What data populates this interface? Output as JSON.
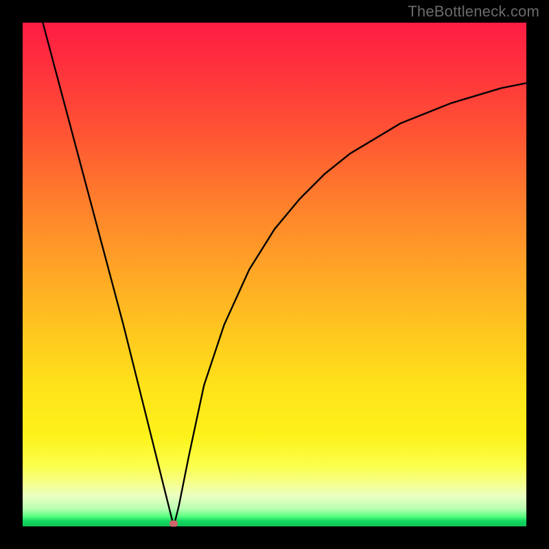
{
  "watermark": "TheBottleneck.com",
  "chart_data": {
    "type": "line",
    "title": "",
    "xlabel": "",
    "ylabel": "",
    "xlim": [
      0,
      100
    ],
    "ylim": [
      0,
      100
    ],
    "legend": false,
    "grid": false,
    "x": [
      4,
      8,
      12,
      16,
      20,
      24,
      27,
      29,
      30,
      31,
      33,
      36,
      40,
      45,
      50,
      55,
      60,
      65,
      70,
      75,
      80,
      85,
      90,
      95,
      100
    ],
    "values": [
      100,
      85,
      70,
      55,
      40,
      24,
      12,
      4,
      0,
      4,
      14,
      28,
      40,
      51,
      59,
      65,
      70,
      74,
      77,
      80,
      82,
      84,
      85.5,
      87,
      88
    ],
    "marker": {
      "x": 30,
      "y": 0.5
    },
    "background_gradient": {
      "orientation": "vertical",
      "stops": [
        {
          "pos": 0.0,
          "color": "#ff1c44"
        },
        {
          "pos": 0.35,
          "color": "#ff7a2d"
        },
        {
          "pos": 0.72,
          "color": "#ffe21a"
        },
        {
          "pos": 0.92,
          "color": "#f7ff84"
        },
        {
          "pos": 1.0,
          "color": "#10c65a"
        }
      ]
    }
  }
}
